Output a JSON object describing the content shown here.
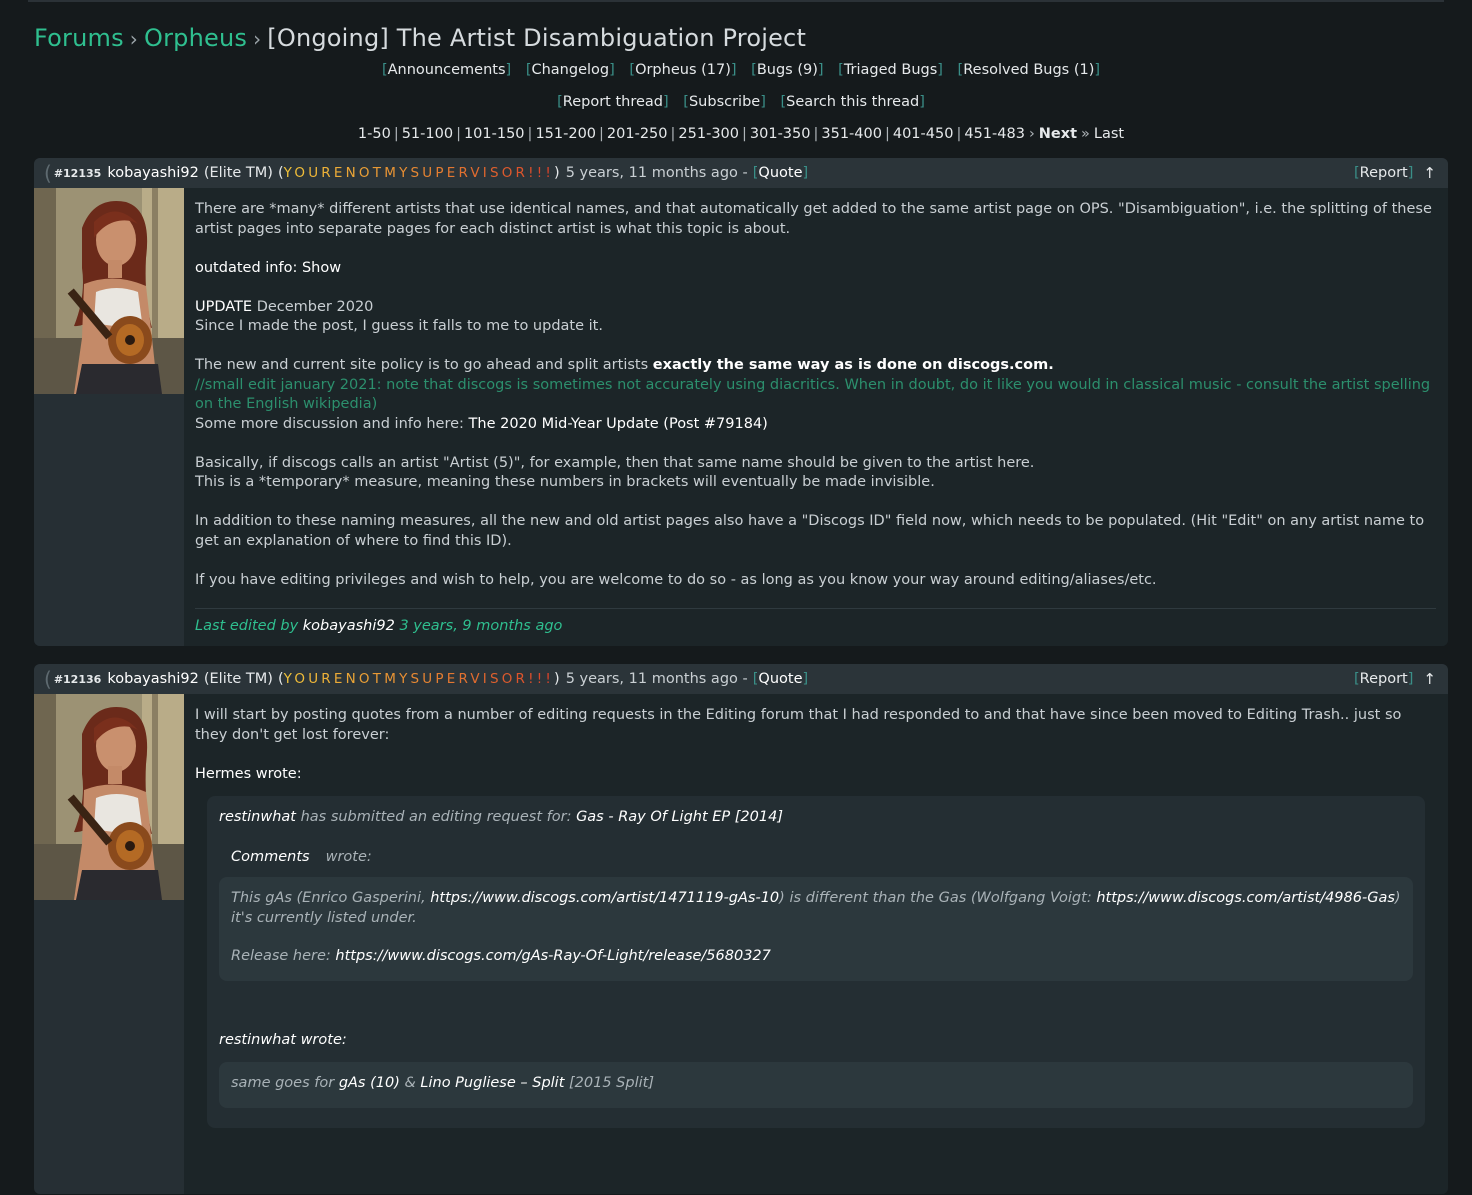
{
  "breadcrumb": {
    "forums": "Forums",
    "forum": "Orpheus",
    "sep": "›",
    "thread_title": "[Ongoing] The Artist Disambiguation Project"
  },
  "subforum_links": [
    "Announcements",
    "Changelog",
    "Orpheus (17)",
    "Bugs (9)",
    "Triaged Bugs",
    "Resolved Bugs (1)"
  ],
  "thread_actions": [
    "Report thread",
    "Subscribe",
    "Search this thread"
  ],
  "pagination": {
    "pages": [
      "1-50",
      "51-100",
      "101-150",
      "151-200",
      "201-250",
      "251-300",
      "301-350",
      "351-400",
      "401-450",
      "451-483"
    ],
    "next_arrow": "›",
    "next": "Next",
    "last_arrow": "»",
    "last": "Last"
  },
  "user_title_letters": [
    "Y",
    "O",
    "U",
    "R",
    "E",
    "N",
    "O",
    "T",
    "M",
    "Y",
    "S",
    "U",
    "P",
    "E",
    "R",
    "V",
    "I",
    "S",
    "O",
    "R",
    "!",
    "!",
    "!"
  ],
  "colors": {
    "accent": "#2fbf8f",
    "bracket": "#3a8f88",
    "rainbow_start": "#f0c23a",
    "rainbow_end": "#d9432a",
    "edit_note": "#2c8f6d"
  },
  "post1": {
    "id": "#12135",
    "user": "kobayashi92",
    "class": "(Elite TM)",
    "time": "5 years, 11 months ago -",
    "quote": "Quote",
    "report": "Report",
    "up": "↑",
    "body": {
      "p1": "There are *many* different artists that use identical names, and that automatically get added to the same artist page on OPS. \"Disambiguation\", i.e. the splitting of these artist pages into separate pages for each distinct artist is what this topic is about.",
      "outdated_label": "outdated info:",
      "outdated_show": "Show",
      "update_label": "UPDATE",
      "update_date": "December 2020",
      "p3": "Since I made the post, I guess it falls to me to update it.",
      "p4a": "The new and current site policy is to go ahead and split artists",
      "p4b": "exactly the same way as is done on discogs.com.",
      "p4c": "//small edit january 2021: note that discogs is sometimes not accurately using diacritics. When in doubt, do it like you would in classical music - consult the artist spelling on the English wikipedia)",
      "p4d": "Some more discussion and info here:",
      "p4e": "The 2020 Mid-Year Update (Post #79184)",
      "p5a": "Basically, if discogs calls an artist \"Artist (5)\", for example, then that same name should be given to the artist here.",
      "p5b": "This is a *temporary* measure, meaning these numbers in brackets will eventually be made invisible.",
      "p6": "In addition to these naming measures, all the new and old artist pages also have a \"Discogs ID\" field now, which needs to be populated. (Hit \"Edit\" on any artist name to get an explanation of where to find this ID).",
      "p7": "If you have editing privileges and wish to help, you are welcome to do so - as long as you know your way around editing/aliases/etc.",
      "edited_prefix": "Last edited by",
      "edited_user": "kobayashi92",
      "edited_time": "3 years, 9 months ago"
    }
  },
  "post2": {
    "id": "#12136",
    "user": "kobayashi92",
    "class": "(Elite TM)",
    "time": "5 years, 11 months ago -",
    "quote": "Quote",
    "report": "Report",
    "up": "↑",
    "body": {
      "intro": "I will start by posting quotes from a number of editing requests in the Editing forum that I had responded to and that have since been moved to Editing Trash.. just so they don't get lost forever:",
      "hermes": "Hermes wrote:",
      "q_user": "restinwhat",
      "q_text": "has submitted an editing request for:",
      "q_release": "Gas - Ray Of Light EP [2014]",
      "comments_label": "Comments",
      "comments_wrote": "wrote:",
      "c1a": "This gAs (Enrico Gasperini,",
      "c1b": "https://www.discogs.com/artist/1471119-gAs-10",
      "c1c": ") is different than the Gas (Wolfgang Voigt:",
      "c1d": "https://www.discogs.com/artist/4986-Gas",
      "c1e": ") it's currently listed under.",
      "c2a": "Release here:",
      "c2b": "https://www.discogs.com/gAs-Ray-Of-Light/release/5680327",
      "rw_user": "restinwhat",
      "rw_wrote": "wrote:",
      "s1": "same goes for",
      "s2": "gAs (10)",
      "s3": "&",
      "s4": "Lino Pugliese – Split",
      "s5": "[2015 Split]"
    }
  }
}
